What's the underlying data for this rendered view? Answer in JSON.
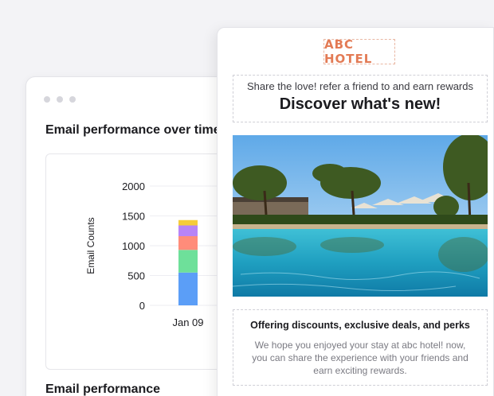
{
  "dashboard": {
    "chart_title": "Email performance over time",
    "bottom_title": "Email performance"
  },
  "chart_data": {
    "type": "bar",
    "stacked": true,
    "categories": [
      "Jan 09"
    ],
    "ylabel": "Email Counts",
    "ylim": [
      0,
      2000
    ],
    "yticks": [
      0,
      500,
      1000,
      1500,
      2000
    ],
    "series": [
      {
        "color": "#5b9ef7",
        "values": [
          550
        ]
      },
      {
        "color": "#6ee09a",
        "values": [
          380
        ]
      },
      {
        "color": "#ff8c7a",
        "values": [
          230
        ]
      },
      {
        "color": "#b784f7",
        "values": [
          180
        ]
      },
      {
        "color": "#f5cc3a",
        "values": [
          90
        ]
      }
    ]
  },
  "email": {
    "logo": "ABC HOTEL",
    "subheading": "Share the love! refer a friend to and earn rewards",
    "headline": "Discover what's new!",
    "offer_title": "Offering discounts, exclusive deals, and perks",
    "offer_body": "We hope you enjoyed your stay at abc hotel! now, you can share the experience with your friends and earn exciting rewards."
  }
}
